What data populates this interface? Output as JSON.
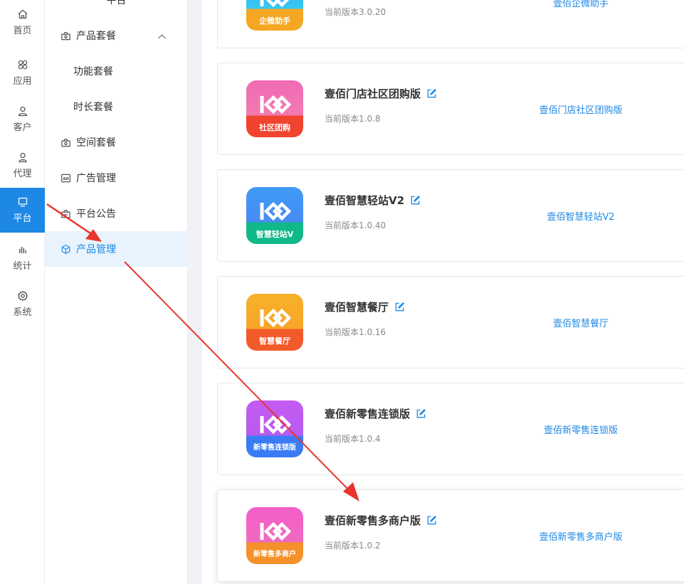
{
  "rail": {
    "items": [
      {
        "label": "首页",
        "icon": "home-icon"
      },
      {
        "label": "应用",
        "icon": "apps-icon"
      },
      {
        "label": "客户",
        "icon": "user-icon"
      },
      {
        "label": "代理",
        "icon": "agent-icon"
      },
      {
        "label": "平台",
        "icon": "monitor-icon",
        "active": true
      },
      {
        "label": "统计",
        "icon": "stats-icon"
      },
      {
        "label": "系统",
        "icon": "gear-icon"
      }
    ]
  },
  "submenu": {
    "title": "平台",
    "items": [
      {
        "label": "产品套餐",
        "icon": "package-icon",
        "expanded": true
      },
      {
        "label": "功能套餐",
        "child": true
      },
      {
        "label": "时长套餐",
        "child": true
      },
      {
        "label": "空间套餐",
        "icon": "package-icon"
      },
      {
        "label": "广告管理",
        "icon": "ad-icon"
      },
      {
        "label": "平台公告",
        "icon": "notice-icon"
      },
      {
        "label": "产品管理",
        "icon": "cube-icon",
        "active": true
      }
    ]
  },
  "products": [
    {
      "name": "",
      "version": "当前版本3.0.20",
      "link": "壹佰企微助手",
      "icon_label": "企微助手",
      "icon_colors": [
        "#2bb5f5",
        "#f5a623"
      ]
    },
    {
      "name": "壹佰门店社区团购版",
      "version": "当前版本1.0.8",
      "link": "壹佰门店社区团购版",
      "icon_label": "社区团购",
      "icon_colors": [
        "#f06bb5",
        "#f0442f"
      ]
    },
    {
      "name": "壹佰智慧轻站V2",
      "version": "当前版本1.0.40",
      "link": "壹佰智慧轻站V2",
      "icon_label": "智慧轻站V",
      "icon_colors": [
        "#3d9bf5",
        "#10b88a"
      ]
    },
    {
      "name": "壹佰智慧餐厅",
      "version": "当前版本1.0.16",
      "link": "壹佰智慧餐厅",
      "icon_label": "智慧餐厅",
      "icon_colors": [
        "#f7b12a",
        "#f25a2a"
      ]
    },
    {
      "name": "壹佰新零售连锁版",
      "version": "当前版本1.0.4",
      "link": "壹佰新零售连锁版",
      "icon_label": "新零售连锁版",
      "icon_colors": [
        "#c45bf2",
        "#3b7cf5"
      ]
    },
    {
      "name": "壹佰新零售多商户版",
      "version": "当前版本1.0.2",
      "link": "壹佰新零售多商户版",
      "icon_label": "新零售多商户",
      "icon_colors": [
        "#f45ec8",
        "#f5912a"
      ]
    }
  ],
  "colors": {
    "accent": "#1e88e5",
    "arrow": "#e8352e"
  }
}
